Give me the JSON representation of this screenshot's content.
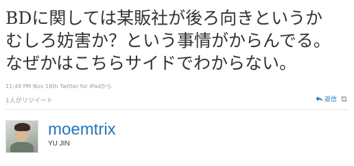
{
  "tweet": {
    "lines": [
      "BDに関しては某販社が後ろ向きというか",
      "むしろ妨害か？という事情がからんでる。",
      "なぜかはこちらサイドでわからない。"
    ]
  },
  "meta": {
    "time": "11:49 PM Nov 18th",
    "via": "Twitter for iPad",
    "suffix": "から"
  },
  "retweet_count_text": "1人がリツイート",
  "actions": {
    "reply_label": "返信",
    "retweet_icon": "retweet-icon",
    "reply_icon": "reply-icon"
  },
  "author": {
    "screen_name": "moemtrix",
    "full_name": "YU JIN"
  },
  "colors": {
    "link": "#2276bb",
    "meta": "#999999"
  }
}
